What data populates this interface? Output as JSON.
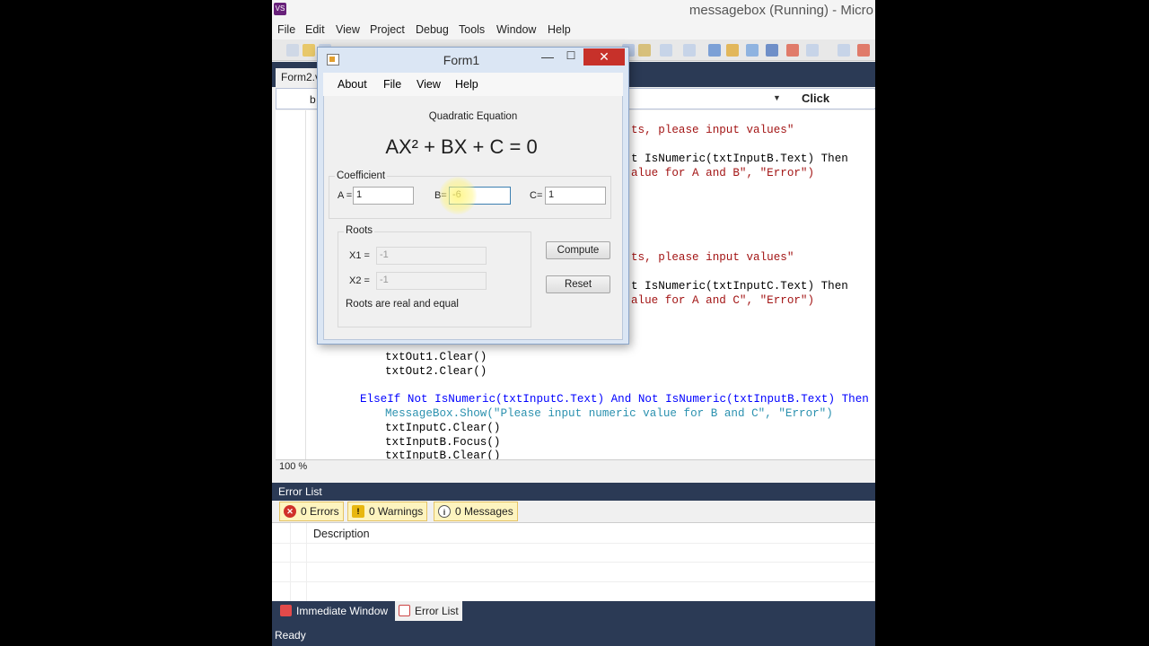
{
  "vs": {
    "window_title": "messagebox (Running) - Micro",
    "logo": "VS",
    "menu": [
      "File",
      "Edit",
      "View",
      "Project",
      "Debug",
      "Tools",
      "Window",
      "Help"
    ],
    "doc_tab": "Form2.v",
    "nav_left": "b",
    "nav_right": "Click",
    "zoom": "100 %",
    "status": "Ready"
  },
  "code": [
    "ts, please input values\"",
    "t IsNumeric(txtInputB.Text) Then",
    "alue for A and B\", \"Error\")",
    "ts, please input values\"",
    "t IsNumeric(txtInputC.Text) Then",
    "alue for A and C\", \"Error\")",
    "txtOut1.Clear()",
    "txtOut2.Clear()",
    "ElseIf Not IsNumeric(txtInputC.Text) And Not IsNumeric(txtInputB.Text) Then",
    "MessageBox.Show(\"Please input numeric value for B and C\", \"Error\")",
    "txtInputC.Clear()",
    "txtInputB.Focus()",
    "txtInputB.Clear()"
  ],
  "error_list": {
    "title": "Error List",
    "errors": "0 Errors",
    "warnings": "0 Warnings",
    "messages": "0 Messages",
    "column_description": "Description"
  },
  "bottom_tabs": {
    "immediate": "Immediate Window",
    "errors": "Error List"
  },
  "form1": {
    "title": "Form1",
    "close": "✕",
    "menu": {
      "about": "About",
      "file": "File",
      "view": "View",
      "help": "Help"
    },
    "heading": "Quadratic Equation",
    "equation": "AX² + BX + C = 0",
    "coefficient_group": "Coefficient",
    "a_label": "A =",
    "a_value": "1",
    "b_label": "B=",
    "b_value": "-6",
    "c_label": "C=",
    "c_value": "1",
    "roots_group": "Roots",
    "x1_label": "X1 =",
    "x1_value": "-1",
    "x2_label": "X2 =",
    "x2_value": "-1",
    "roots_message": "Roots are real and equal",
    "compute_label": "Compute",
    "reset_label": "Reset"
  },
  "colors": {
    "ide_dark": "#2b3a55",
    "close_red": "#c7312a",
    "keyword": "#0000ff",
    "string": "#a31515",
    "type": "#2b91af"
  }
}
